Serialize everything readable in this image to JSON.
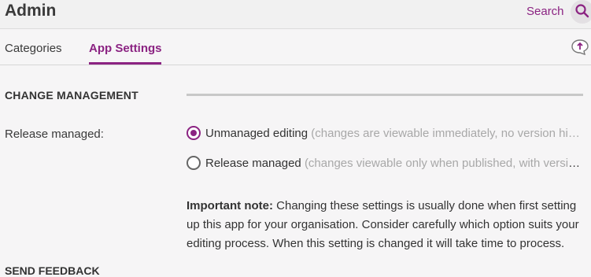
{
  "header": {
    "title": "Admin",
    "search_label": "Search"
  },
  "tabs": [
    {
      "label": "Categories",
      "active": false
    },
    {
      "label": "App Settings",
      "active": true
    }
  ],
  "change_management": {
    "heading": "CHANGE MANAGEMENT",
    "field_label": "Release managed:",
    "options": [
      {
        "label": "Unmanaged editing",
        "hint": "(changes are viewable immediately, no version hi…",
        "selected": true
      },
      {
        "label": "Release managed",
        "hint": "(changes viewable only when published, with versio…",
        "selected": false
      }
    ],
    "note_prefix": "Important note:",
    "note_text": " Changing these settings is usually done when first setting up this app for your organisation. Consider carefully which option suits your editing process. When this setting is changed it will take time to process."
  },
  "send_feedback": {
    "heading": "SEND FEEDBACK"
  },
  "colors": {
    "accent": "#8b2382",
    "background": "#f6f5f6"
  },
  "icons": {
    "search": "search-icon",
    "upload": "upload-icon"
  }
}
